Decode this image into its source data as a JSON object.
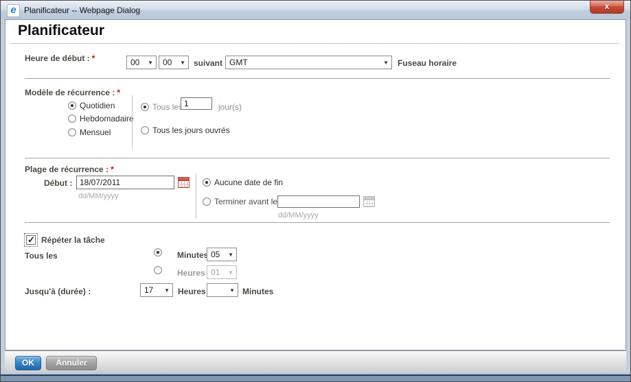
{
  "window": {
    "title": "Planificateur -- Webpage Dialog",
    "close": "x"
  },
  "page": {
    "heading": "Planificateur"
  },
  "start_time": {
    "label": "Heure de début :",
    "required": "*",
    "hour": "00",
    "minute": "00",
    "suivant": "suivant",
    "timezone": "GMT",
    "timezone_label": "Fuseau horaire"
  },
  "pattern": {
    "label": "Modèle de récurrence :",
    "required": "*",
    "options": [
      "Quotidien",
      "Hebdomadaire",
      "Mensuel"
    ],
    "selected_option": "Quotidien",
    "every_label": "Tous les",
    "every_value": "1",
    "every_unit": "jour(s)",
    "weekdays_label": "Tous les jours ouvrés"
  },
  "range": {
    "label": "Plage de récurrence :",
    "required": "*",
    "start_label": "Début :",
    "start_value": "18/07/2011",
    "start_format": "dd/MM/yyyy",
    "no_end_label": "Aucune date de fin",
    "end_label": "Terminer avant le :",
    "end_value": "",
    "end_format": "dd/MM/yyyy"
  },
  "repeat": {
    "label": "Répéter la tâche",
    "checked": true,
    "every_label": "Tous les",
    "minutes_label": "Minutes",
    "minutes_value": "05",
    "hours_label": "Heures",
    "hours_value": "01",
    "until_label": "Jusqu'à (durée) :",
    "until_hours": "17",
    "until_hours_label": "Heures",
    "until_minutes": "",
    "until_minutes_label": "Minutes"
  },
  "footer": {
    "ok": "OK",
    "cancel": "Annuler"
  }
}
